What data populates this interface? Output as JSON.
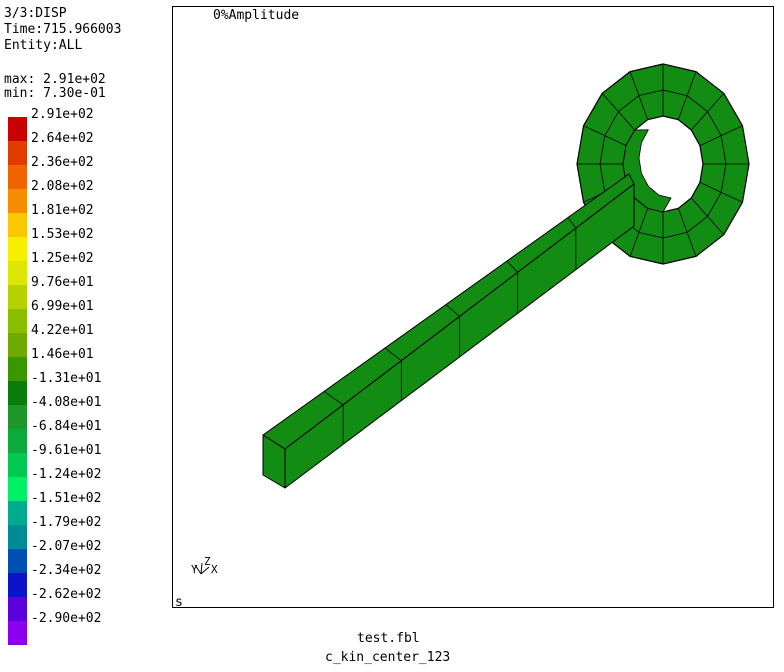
{
  "header": {
    "step": "3/3:DISP",
    "time": "Time:715.966003",
    "entity": "Entity:ALL",
    "max": "max: 2.91e+02",
    "min": "min: 7.30e-01"
  },
  "legend": {
    "levels": [
      {
        "label": "2.91e+02",
        "color": "#c80000"
      },
      {
        "label": "2.64e+02",
        "color": "#e03c00"
      },
      {
        "label": "2.36e+02",
        "color": "#f06400"
      },
      {
        "label": "2.08e+02",
        "color": "#f68c00"
      },
      {
        "label": "1.81e+02",
        "color": "#fac800"
      },
      {
        "label": "1.53e+02",
        "color": "#f6f000"
      },
      {
        "label": "1.25e+02",
        "color": "#dce600"
      },
      {
        "label": "9.76e+01",
        "color": "#b4d200"
      },
      {
        "label": "6.99e+01",
        "color": "#8cbe00"
      },
      {
        "label": "4.22e+01",
        "color": "#6eaa00"
      },
      {
        "label": "1.46e+01",
        "color": "#3c9600"
      },
      {
        "label": "-1.31e+01",
        "color": "#0a7d0a"
      },
      {
        "label": "-4.08e+01",
        "color": "#1e9628"
      },
      {
        "label": "-6.84e+01",
        "color": "#0aaa3c"
      },
      {
        "label": "-9.61e+01",
        "color": "#00c850"
      },
      {
        "label": "-1.24e+02",
        "color": "#00f064"
      },
      {
        "label": "-1.51e+02",
        "color": "#00aa8c"
      },
      {
        "label": "-1.79e+02",
        "color": "#008c96"
      },
      {
        "label": "-2.07e+02",
        "color": "#0050b4"
      },
      {
        "label": "-2.34e+02",
        "color": "#0a14c8"
      },
      {
        "label": "-2.62e+02",
        "color": "#5a00dc"
      },
      {
        "label": "-2.90e+02",
        "color": "#8c00f0"
      }
    ]
  },
  "viewport": {
    "title": "0%Amplitude",
    "corner_label": "s",
    "triad": {
      "y": "Y",
      "z": "Z",
      "x": "X"
    },
    "model_color": "#138c13"
  },
  "footer": {
    "file": "test.fbl",
    "job": "c_kin_center_123"
  }
}
